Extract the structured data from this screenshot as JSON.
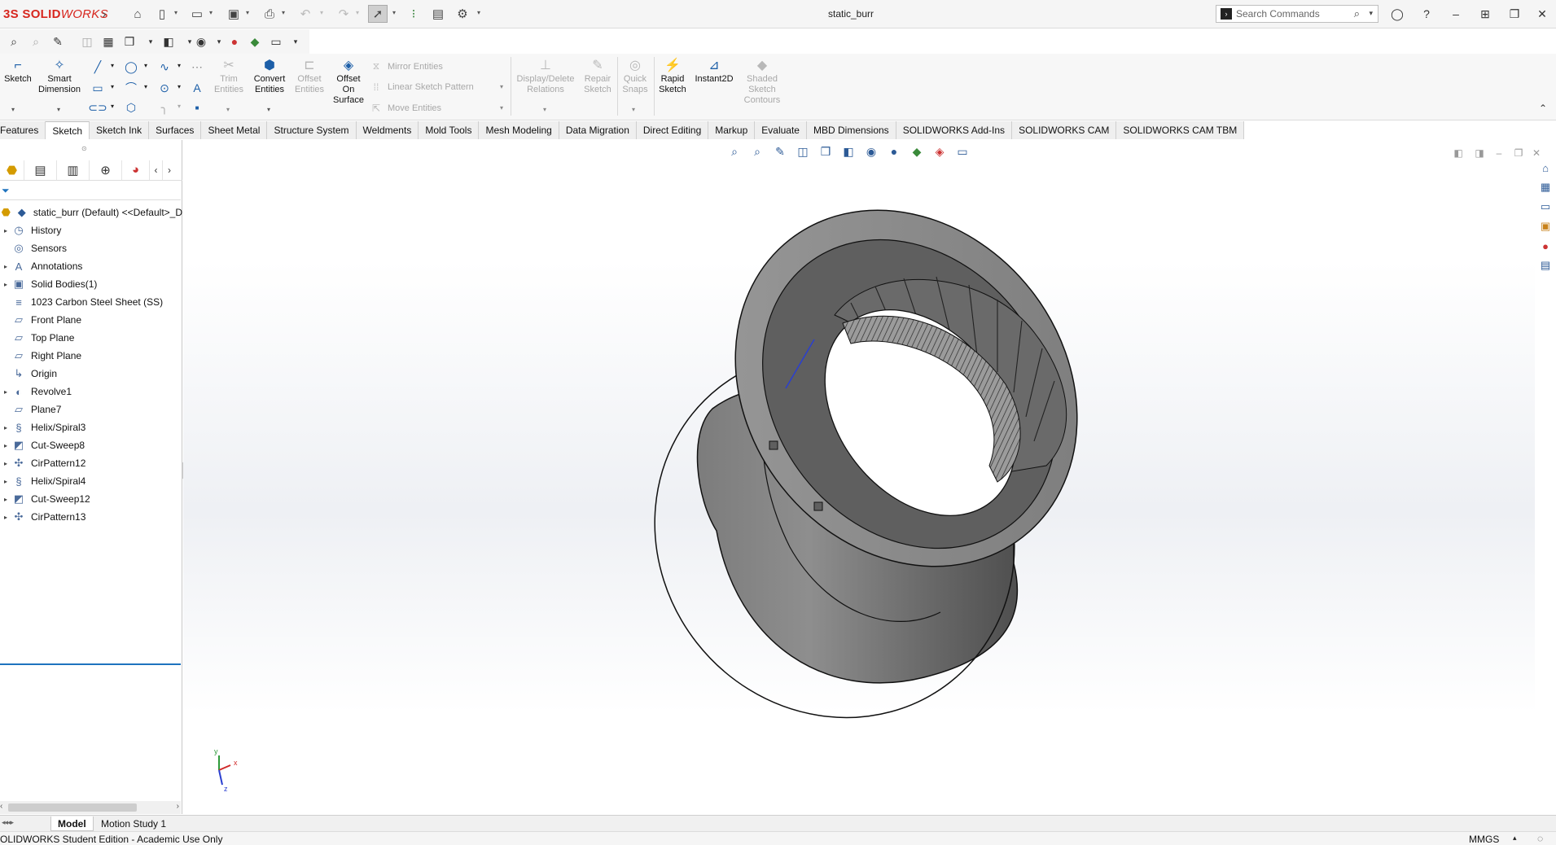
{
  "app": {
    "logo_text_bold": "3S SOLID",
    "logo_text_rest": "WORKS",
    "document_title": "static_burr"
  },
  "search": {
    "placeholder": "Search Commands"
  },
  "command_manager": {
    "sketch": "Sketch",
    "smart_dimension": "Smart\nDimension",
    "trim_entities": "Trim\nEntities",
    "convert_entities": "Convert\nEntities",
    "offset_entities": "Offset\nEntities",
    "offset_on_surface": "Offset\nOn\nSurface",
    "mirror_entities": "Mirror Entities",
    "linear_sketch_pattern": "Linear Sketch Pattern",
    "move_entities": "Move Entities",
    "display_delete_relations": "Display/Delete\nRelations",
    "repair_sketch": "Repair\nSketch",
    "quick_snaps": "Quick\nSnaps",
    "rapid_sketch": "Rapid\nSketch",
    "instant2d": "Instant2D",
    "shaded_sketch_contours": "Shaded\nSketch\nContours"
  },
  "tabs": [
    "Features",
    "Sketch",
    "Sketch Ink",
    "Surfaces",
    "Sheet Metal",
    "Structure System",
    "Weldments",
    "Mold Tools",
    "Mesh Modeling",
    "Data Migration",
    "Direct Editing",
    "Markup",
    "Evaluate",
    "MBD Dimensions",
    "SOLIDWORKS Add-Ins",
    "SOLIDWORKS CAM",
    "SOLIDWORKS CAM TBM"
  ],
  "active_tab": "Sketch",
  "tree": {
    "root": "static_burr (Default) <<Default>_D",
    "items": [
      {
        "label": "History",
        "icon": "history-icon",
        "expandable": true
      },
      {
        "label": "Sensors",
        "icon": "sensor-icon",
        "expandable": false
      },
      {
        "label": "Annotations",
        "icon": "annotation-icon",
        "expandable": true
      },
      {
        "label": "Solid Bodies(1)",
        "icon": "solid-body-icon",
        "expandable": true
      },
      {
        "label": "1023 Carbon Steel Sheet (SS)",
        "icon": "material-icon",
        "expandable": false
      },
      {
        "label": "Front Plane",
        "icon": "plane-icon",
        "expandable": false
      },
      {
        "label": "Top Plane",
        "icon": "plane-icon",
        "expandable": false
      },
      {
        "label": "Right Plane",
        "icon": "plane-icon",
        "expandable": false
      },
      {
        "label": "Origin",
        "icon": "origin-icon",
        "expandable": false
      },
      {
        "label": "Revolve1",
        "icon": "revolve-icon",
        "expandable": true
      },
      {
        "label": "Plane7",
        "icon": "plane-icon",
        "expandable": false
      },
      {
        "label": "Helix/Spiral3",
        "icon": "helix-icon",
        "expandable": true
      },
      {
        "label": "Cut-Sweep8",
        "icon": "cut-sweep-icon",
        "expandable": true
      },
      {
        "label": "CirPattern12",
        "icon": "circular-pattern-icon",
        "expandable": true
      },
      {
        "label": "Helix/Spiral4",
        "icon": "helix-icon",
        "expandable": true
      },
      {
        "label": "Cut-Sweep12",
        "icon": "cut-sweep-icon",
        "expandable": true
      },
      {
        "label": "CirPattern13",
        "icon": "circular-pattern-icon",
        "expandable": true
      }
    ]
  },
  "bottom_tabs": [
    "Model",
    "Motion Study 1"
  ],
  "status": {
    "left": "OLIDWORKS Student Edition - Academic Use Only",
    "units": "MMGS"
  },
  "triad": {
    "x": "x",
    "y": "y",
    "z": "z"
  },
  "colors": {
    "brand_red": "#d7261e",
    "accent_blue": "#1e73be",
    "model_gray": "#6e6e6e"
  }
}
